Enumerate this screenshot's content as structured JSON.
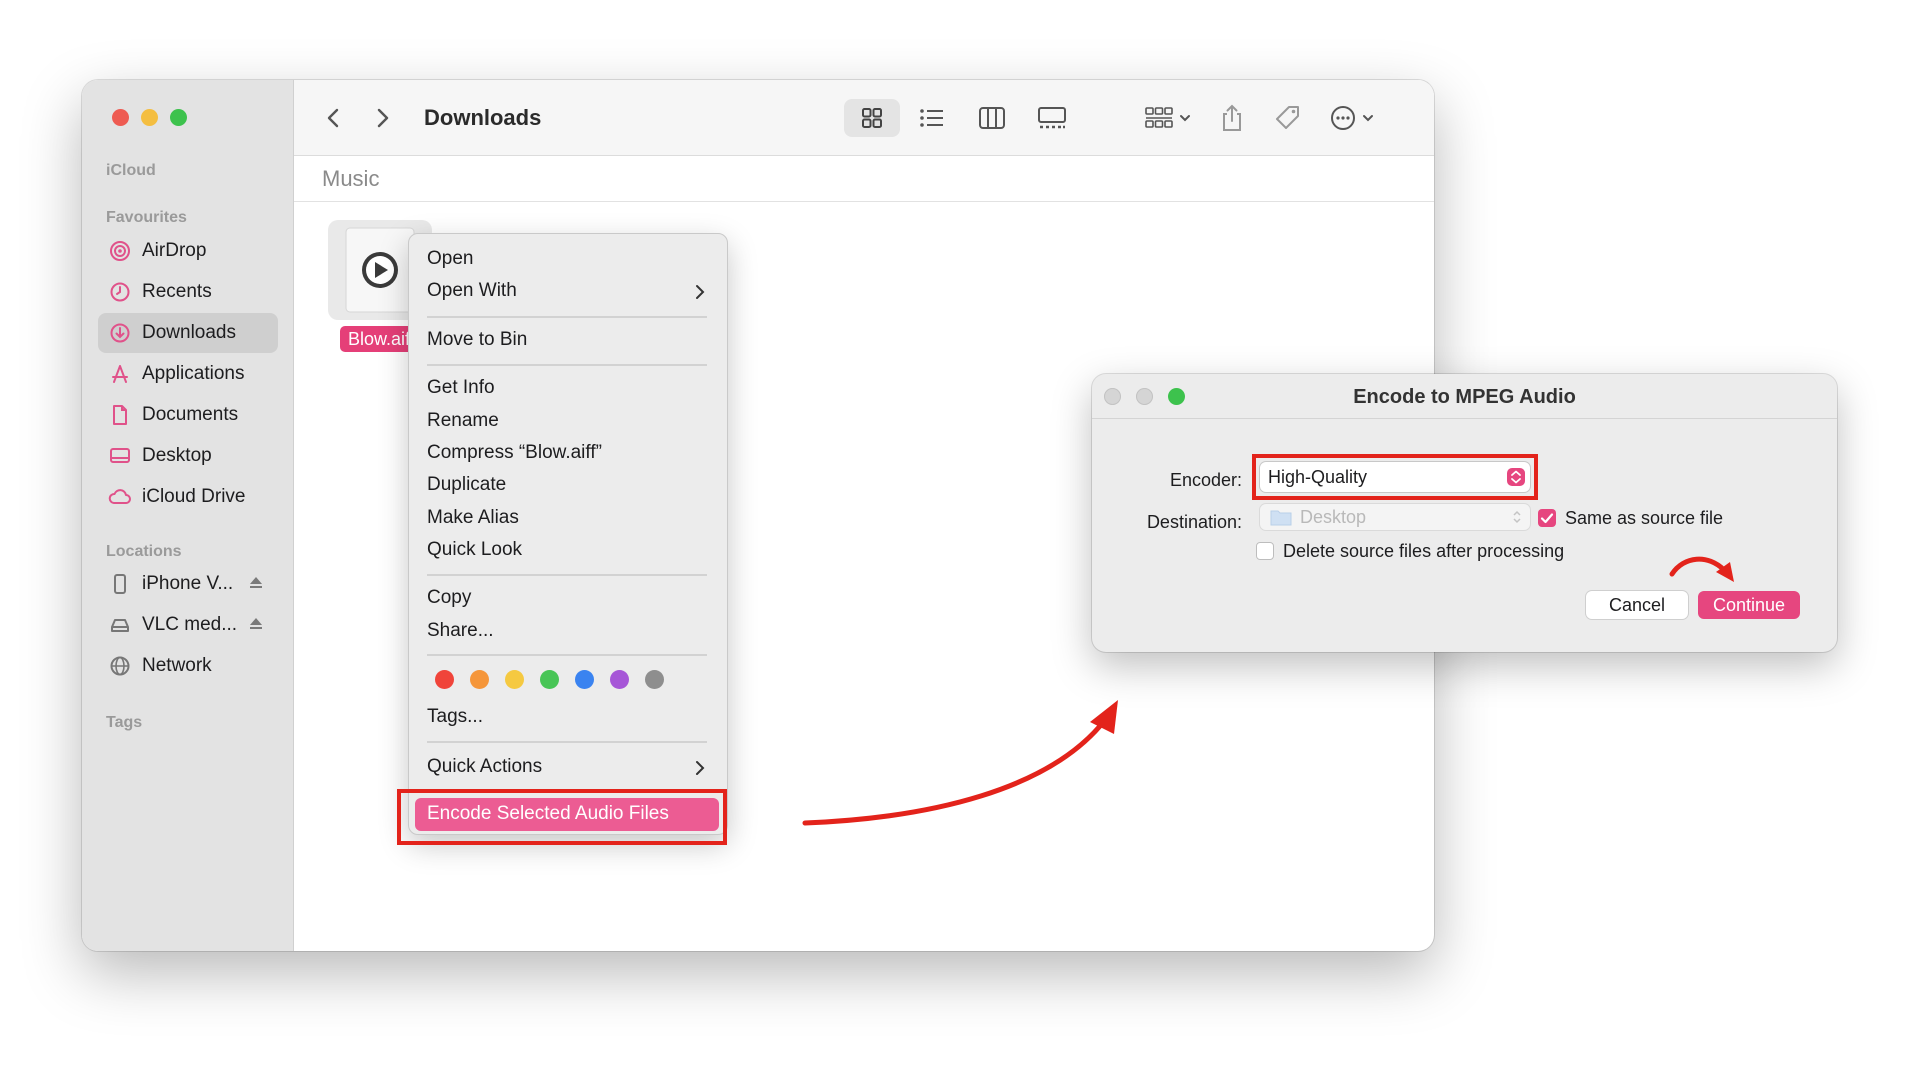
{
  "finder": {
    "title": "Downloads",
    "path_section": "Music",
    "sidebar": {
      "icloud_header": "iCloud",
      "favourites_header": "Favourites",
      "favourites": [
        {
          "label": "AirDrop",
          "icon": "airdrop-icon"
        },
        {
          "label": "Recents",
          "icon": "clock-icon"
        },
        {
          "label": "Downloads",
          "icon": "download-icon",
          "selected": true
        },
        {
          "label": "Applications",
          "icon": "applications-icon"
        },
        {
          "label": "Documents",
          "icon": "document-icon"
        },
        {
          "label": "Desktop",
          "icon": "desktop-icon"
        },
        {
          "label": "iCloud Drive",
          "icon": "cloud-icon"
        }
      ],
      "locations_header": "Locations",
      "locations": [
        {
          "label": "iPhone V...",
          "icon": "phone-icon",
          "ejectable": true
        },
        {
          "label": "VLC med...",
          "icon": "disk-icon",
          "ejectable": true
        },
        {
          "label": "Network",
          "icon": "globe-icon"
        }
      ],
      "tags_header": "Tags"
    },
    "file": {
      "name": "Blow.aif",
      "icon": "audio-file-icon"
    }
  },
  "context_menu": {
    "items": {
      "open": "Open",
      "open_with": "Open With",
      "move_to_bin": "Move to Bin",
      "get_info": "Get Info",
      "rename": "Rename",
      "compress": "Compress “Blow.aiff”",
      "duplicate": "Duplicate",
      "make_alias": "Make Alias",
      "quick_look": "Quick Look",
      "copy": "Copy",
      "share": "Share...",
      "tags": "Tags...",
      "quick_actions": "Quick Actions",
      "encode": "Encode Selected Audio Files"
    },
    "tag_colors": [
      "#f0443a",
      "#f5963a",
      "#f5c941",
      "#48c556",
      "#3a83f0",
      "#a656d7",
      "#8e8e8e"
    ]
  },
  "dialog": {
    "title": "Encode to MPEG Audio",
    "encoder_label": "Encoder:",
    "encoder_value": "High-Quality",
    "destination_label": "Destination:",
    "destination_value": "Desktop",
    "same_as_source": "Same as source file",
    "same_as_source_checked": true,
    "delete_source": "Delete source files after processing",
    "delete_source_checked": false,
    "cancel": "Cancel",
    "continue": "Continue"
  },
  "colors": {
    "accent": "#e6467f",
    "highlight_box": "#e3231b"
  }
}
